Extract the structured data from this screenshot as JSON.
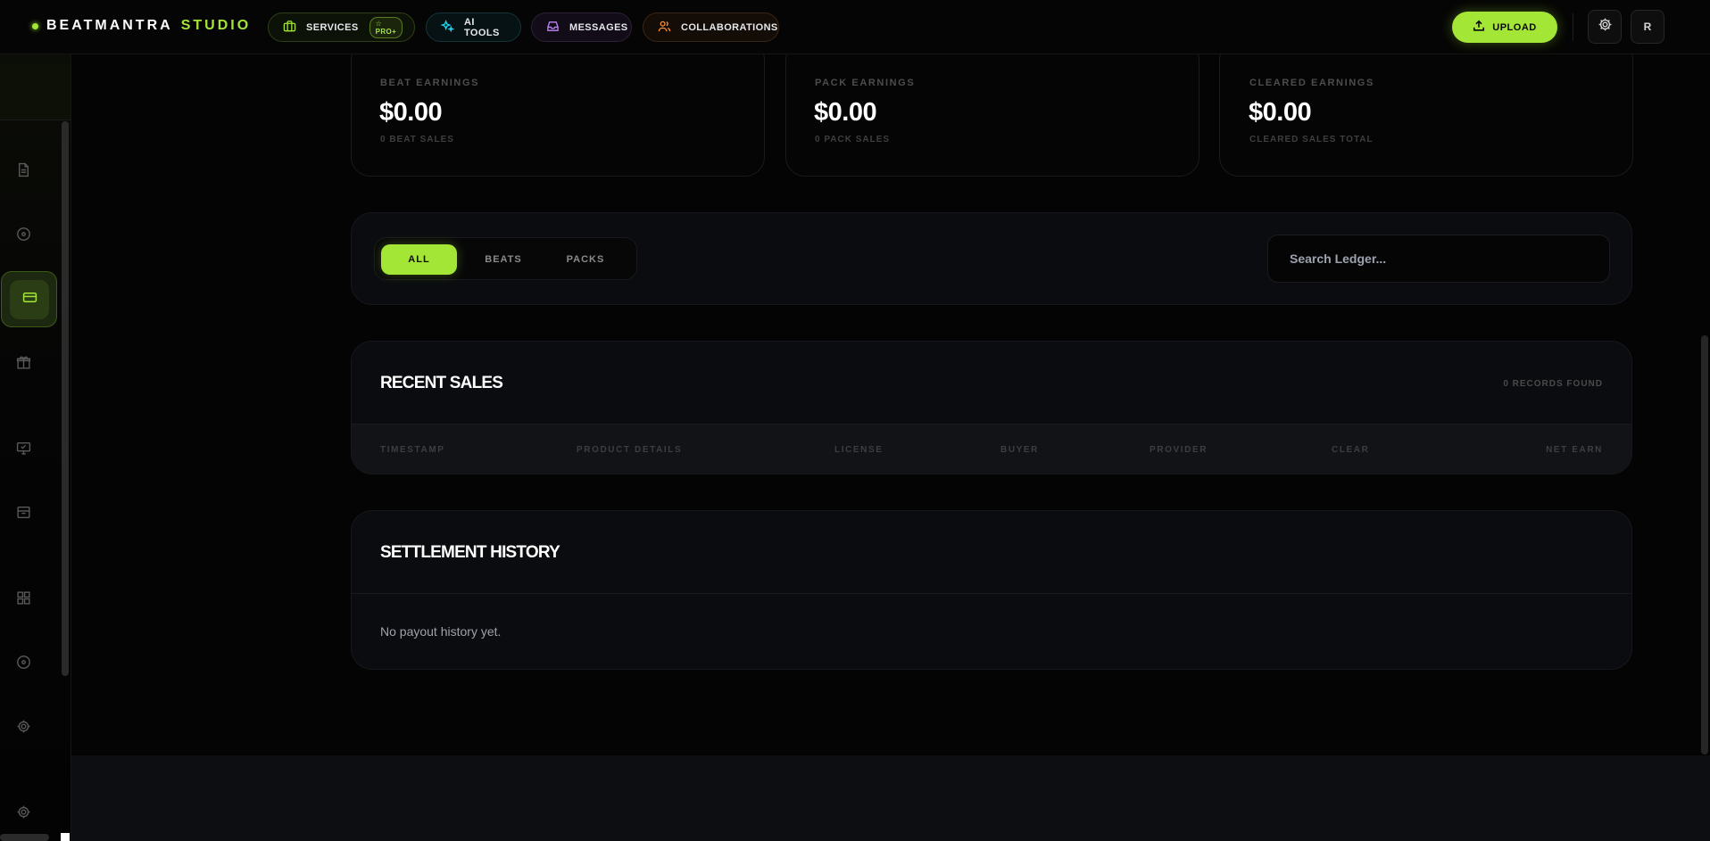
{
  "brand": {
    "name": "BEATMANTRA",
    "accent": "STUDIO"
  },
  "nav": {
    "services": {
      "label": "SERVICES",
      "badge": "☆ PRO+"
    },
    "ai_tools": {
      "label": "AI TOOLS"
    },
    "messages": {
      "label": "MESSAGES"
    },
    "collaborations": {
      "label": "COLLABORATIONS"
    }
  },
  "topbar": {
    "upload_label": "UPLOAD",
    "avatar_initial": "R"
  },
  "colors": {
    "accent": "#a3e635",
    "background": "#040404",
    "panel": "#0b0c10"
  },
  "sidebar": {
    "items": [
      {
        "icon": "file-icon"
      },
      {
        "icon": "disc-icon"
      },
      {
        "icon": "credit-card-icon",
        "active": true
      },
      {
        "icon": "gift-icon"
      },
      {
        "icon": "monitor-icon"
      },
      {
        "icon": "inbox-icon"
      },
      {
        "icon": "grid-icon"
      },
      {
        "icon": "disc-icon"
      },
      {
        "icon": "gear-icon"
      },
      {
        "icon": "gear-icon"
      }
    ]
  },
  "stats": [
    {
      "label": "BEAT EARNINGS",
      "value": "$0.00",
      "sub": "0 BEAT SALES"
    },
    {
      "label": "PACK EARNINGS",
      "value": "$0.00",
      "sub": "0 PACK SALES"
    },
    {
      "label": "CLEARED EARNINGS",
      "value": "$0.00",
      "sub": "CLEARED SALES TOTAL"
    }
  ],
  "filters": {
    "all": "ALL",
    "beats": "BEATS",
    "packs": "PACKS",
    "active": "ALL"
  },
  "search": {
    "placeholder": "Search Ledger..."
  },
  "recent_sales": {
    "title": "RECENT SALES",
    "records": "0 RECORDS FOUND",
    "columns": [
      "TIMESTAMP",
      "PRODUCT DETAILS",
      "LICENSE",
      "BUYER",
      "PROVIDER",
      "CLEAR",
      "NET EARN"
    ]
  },
  "settlement": {
    "title": "SETTLEMENT HISTORY",
    "empty": "No payout history yet."
  }
}
